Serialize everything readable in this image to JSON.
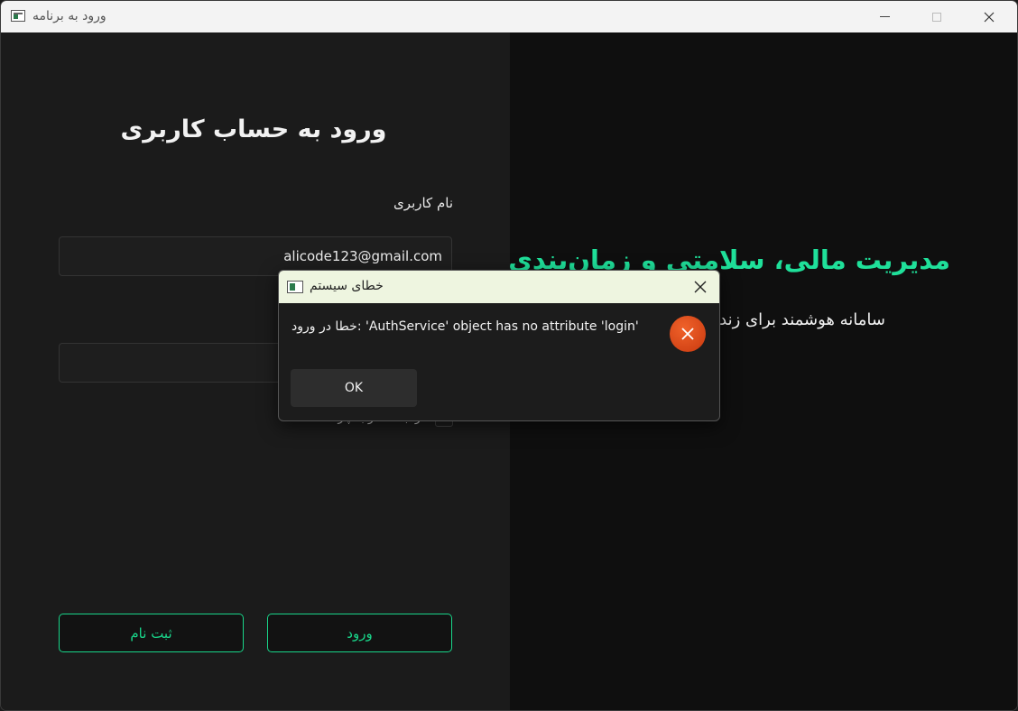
{
  "window": {
    "title": "ورود به برنامه"
  },
  "login": {
    "heading": "ورود به حساب کاربری",
    "username_label": "نام کاربری",
    "username_value": "alicode123@gmail.com",
    "password_value": "",
    "remember_label": "مرا به خاطر بسپار",
    "register_button": "ثبت نام",
    "login_button": "ورود"
  },
  "hero": {
    "title": "مدیریت مالی، سلامتی و زمان‌بندی",
    "subtitle": "سامانه هوشمند برای زندگی"
  },
  "dialog": {
    "title": "خطای سیستم",
    "message": "خطا در ورود: 'AuthService' object has no attribute 'login'",
    "ok_label": "OK",
    "icon": "error-icon"
  },
  "colors": {
    "accent": "#19d68a",
    "error": "#e04a1a",
    "dialog_titlebar": "#eef5e0"
  }
}
